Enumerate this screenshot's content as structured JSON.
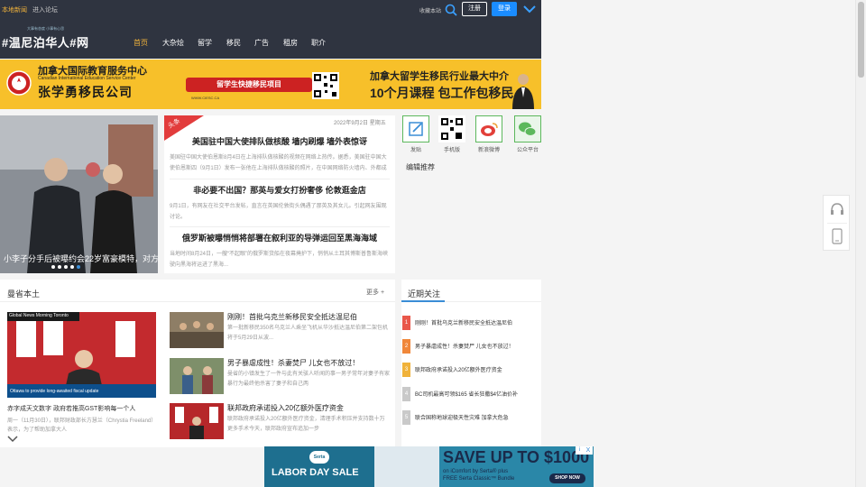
{
  "topbar": {
    "local_news": "本地新闻",
    "enter_portal": "进入论坛",
    "bookmark": "收藏本站",
    "register": "注册",
    "login": "登录"
  },
  "logo": {
    "slogan": "大事有态度 小事有心思",
    "name": "#温尼泊华人#网"
  },
  "nav": [
    "首页",
    "大杂烩",
    "留学",
    "移民",
    "广告",
    "租房",
    "职介"
  ],
  "banner": {
    "org_cn": "加拿大国际教育服务中心",
    "org_en": "Canadian International Education Service Center",
    "company": "张学勇移民公司",
    "fast_track": "留学生快捷移民项目",
    "url": "WWW.CIESC.CA",
    "headline1": "加拿大留学生移民行业最大中介",
    "headline2": "10个月课程 包工作包移民"
  },
  "slider": {
    "caption": "小李子分手后被曝约会22岁富豪模特，对方刚高"
  },
  "headlines": {
    "tag": "头条",
    "date": "2022年9月2日 星期五",
    "items": [
      {
        "title": "美国驻中国大使排队做核酸 墙内刷爆 墙外表惊讶",
        "desc": "美国驻中国大使伯恩斯8月4日在上海排队做核酸的视频在网络上热传。据悉，美国驻中国大使伯恩斯四（9月1日）发布一张他在上海排队做核酸的照片，在中国网络防火墙内、外都成为热议焦"
      },
      {
        "title": "非必要不出国？那英与爱女打扮奢侈 伦敦逛金店",
        "desc": "9月1日，有网友在社交平台发帖，直言在英国伦敦街头偶遇了那英及其女儿。引起网友围观讨论。"
      },
      {
        "title": "俄罗斯被曝悄悄将部署在叙利亚的导弹运回至黑海海域",
        "desc": "当地时间8月24日，一艘“不起眼”的俄罗斯货船在夜幕掩护下，悄悄从土耳其博斯普鲁斯海峡驶向黑海将运进了黑海..."
      }
    ]
  },
  "quick_links": [
    {
      "label": "发贴",
      "icon": "edit-icon"
    },
    {
      "label": "手机版",
      "icon": "qr-icon"
    },
    {
      "label": "新浪微博",
      "icon": "weibo-icon"
    },
    {
      "label": "公众平台",
      "icon": "wechat-icon"
    }
  ],
  "editor_pick": "编辑推荐",
  "local": {
    "title": "曼省本土",
    "more": "更多 +",
    "featured": {
      "image_caption": "Ottawa to provide long-awaited fiscal update",
      "image_banner": "Global News Morning Toronto",
      "title": "赤字成天文数字 政府若推高GST影响每一个人",
      "desc": "周一（11月30日），联邦财政部长方慧兰（Chrystia Freeland）表示，为了帮助加拿大人"
    },
    "items": [
      {
        "title": "刚刚！首批乌克兰新移民安全抵达温尼伯",
        "desc": "第一批新移民350名乌克兰人乘坐飞机从华沙抵达温尼伯第二架包机将于5月29日从波..."
      },
      {
        "title": "男子暴虐成性！杀妻焚尸 儿女也不放过！",
        "desc": "曼省的小镇发生了一件与此有关骇人听闻的事一男子常年对妻子有家暴行为最终他杀害了妻子和自己两"
      },
      {
        "title": "联邦政府承诺投入20亿额外医疗资金",
        "desc": "联邦政府承诺投入20亿额外医疗资金，清理手术积压并支持数十万更多手术今天，联邦政府宣布追加一步"
      }
    ]
  },
  "recent": {
    "title": "近期关注",
    "items": [
      {
        "n": "1",
        "title": "刚刚！首批乌克兰新移民安全抵达温尼伯",
        "color": "#e9574a"
      },
      {
        "n": "2",
        "title": "男子暴虐成性！杀妻焚尸 儿女也不放过！",
        "color": "#f0873a"
      },
      {
        "n": "3",
        "title": "联邦政府承诺投入20亿额外医疗资金",
        "color": "#f0b23a"
      },
      {
        "n": "4",
        "title": "BC司机最高可领$165 省长狂撒$4亿油价补",
        "color": "#c9c9c9"
      },
      {
        "n": "5",
        "title": "联合国称地球迎极天性灾难 加拿大危急",
        "color": "#c9c9c9"
      }
    ]
  },
  "ad": {
    "left": "LABOR DAY SALE",
    "brand": "Serta",
    "save": "SAVE UP TO $1000",
    "sub1": "on iComfort by Serta® plus",
    "sub2": "FREE Serta Classic™ Bundle",
    "shop": "SHOP NOW",
    "ad_mark": "i",
    "close": "X"
  }
}
